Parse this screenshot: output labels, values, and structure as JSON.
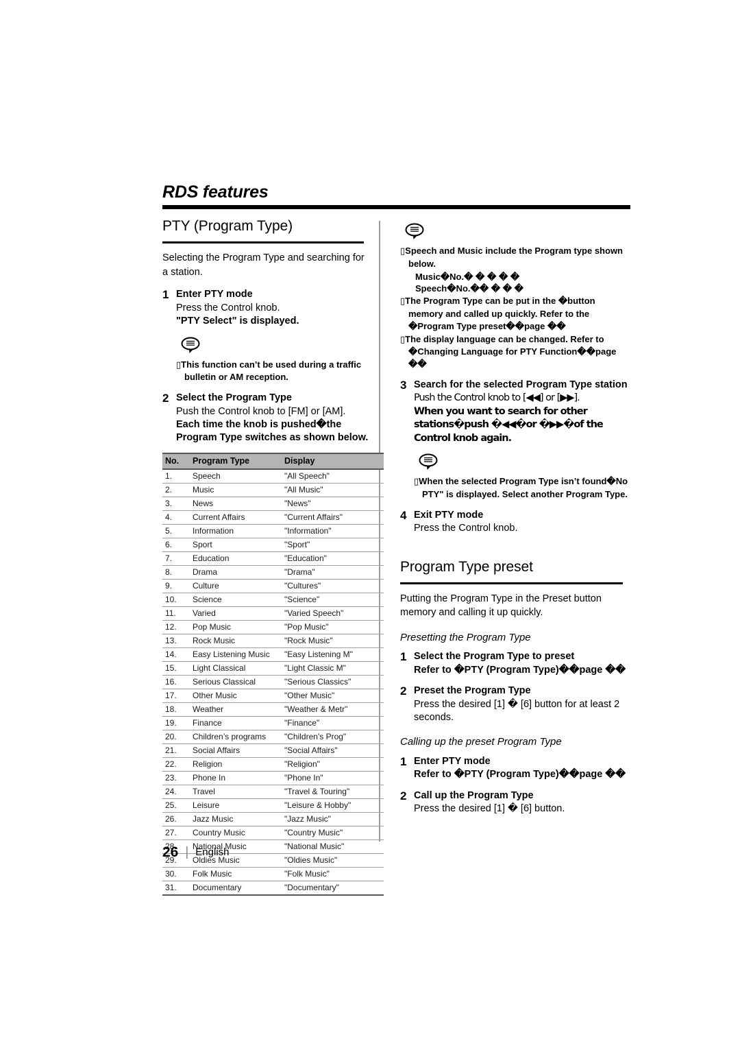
{
  "header": {
    "chapter_title": "RDS features"
  },
  "left_column": {
    "section": {
      "heading": "PTY (Program Type)",
      "intro": "Selecting the Program Type and searching for a station."
    },
    "steps": [
      {
        "num": "1",
        "title": "Enter PTY mode",
        "lines": [
          {
            "text": "Press the Control knob.",
            "bold": false
          },
          {
            "text": "\"PTY Select\" is displayed.",
            "bold": true
          }
        ]
      },
      {
        "num": "2",
        "title": "Select the Program Type",
        "lines": [
          {
            "text": "Push the Control knob to [FM] or [AM].",
            "bold": false
          },
          {
            "text": "Each time the knob is pushed�the Program Type switches as shown below.",
            "bold": true
          }
        ]
      }
    ],
    "note": {
      "icon": "speech-bubble-note-icon",
      "items": [
        "This function can’t be used during a traffic bulletin or AM reception."
      ]
    },
    "table": {
      "columns": [
        "No.",
        "Program Type",
        "Display"
      ],
      "rows": [
        [
          "1.",
          "Speech",
          "\"All Speech\""
        ],
        [
          "2.",
          "Music",
          "\"All Music\""
        ],
        [
          "3.",
          "News",
          "\"News\""
        ],
        [
          "4.",
          "Current Affairs",
          "\"Current Affairs\""
        ],
        [
          "5.",
          "Information",
          "\"Information\""
        ],
        [
          "6.",
          "Sport",
          "\"Sport\""
        ],
        [
          "7.",
          "Education",
          "\"Education\""
        ],
        [
          "8.",
          "Drama",
          "\"Drama\""
        ],
        [
          "9.",
          "Culture",
          "\"Cultures\""
        ],
        [
          "10.",
          "Science",
          "\"Science\""
        ],
        [
          "11.",
          "Varied",
          "\"Varied Speech\""
        ],
        [
          "12.",
          "Pop Music",
          "\"Pop Music\""
        ],
        [
          "13.",
          "Rock Music",
          "\"Rock Music\""
        ],
        [
          "14.",
          "Easy Listening Music",
          "\"Easy Listening M\""
        ],
        [
          "15.",
          "Light Classical",
          "\"Light Classic M\""
        ],
        [
          "16.",
          "Serious Classical",
          "\"Serious Classics\""
        ],
        [
          "17.",
          "Other Music",
          "\"Other Music\""
        ],
        [
          "18.",
          "Weather",
          "\"Weather & Metr\""
        ],
        [
          "19.",
          "Finance",
          "\"Finance\""
        ],
        [
          "20.",
          "Children’s programs",
          "\"Children's Prog\""
        ],
        [
          "21.",
          "Social Affairs",
          "\"Social Affairs\""
        ],
        [
          "22.",
          "Religion",
          "\"Religion\""
        ],
        [
          "23.",
          "Phone In",
          "\"Phone In\""
        ],
        [
          "24.",
          "Travel",
          "\"Travel & Touring\""
        ],
        [
          "25.",
          "Leisure",
          "\"Leisure & Hobby\""
        ],
        [
          "26.",
          "Jazz Music",
          "\"Jazz Music\""
        ],
        [
          "27.",
          "Country Music",
          "\"Country Music\""
        ],
        [
          "28.",
          "National Music",
          "\"National Music\""
        ],
        [
          "29.",
          "Oldies Music",
          "\"Oldies Music\""
        ],
        [
          "30.",
          "Folk Music",
          "\"Folk Music\""
        ],
        [
          "31.",
          "Documentary",
          "\"Documentary\""
        ]
      ]
    }
  },
  "right_column": {
    "top_note": {
      "icon": "speech-bubble-note-icon",
      "item1": "Speech and Music include the Program type shown below.",
      "music_line": "Music�No.� �  �    �  �",
      "speech_line": "Speech�No.��  �    �  �",
      "item2": "The Program Type can be put in the �button memory and called up quickly. Refer to the �Program Type preset��page ��",
      "item3": "The display language can be changed. Refer to �Changing Language for PTY Function��page ��"
    },
    "steps": [
      {
        "num": "3",
        "title": "Search for the selected Program Type station",
        "lines": [
          {
            "text": "Push the Control knob to [◀◀] or [▶▶].",
            "bold": false
          },
          {
            "text": "When you want to search for other stations�push �◀◀�or �▶▶�of the Control knob again.",
            "bold": true
          }
        ]
      },
      {
        "num": "4",
        "title": "Exit PTY mode",
        "lines": [
          {
            "text": "Press the Control knob.",
            "bold": false
          }
        ]
      }
    ],
    "mid_note": {
      "icon": "speech-bubble-note-icon",
      "items": [
        "When the selected Program Type isn’t found�No PTY\" is displayed. Select another Program Type."
      ]
    },
    "preset_section": {
      "heading": "Program Type preset",
      "intro": "Putting the Program Type in the Preset button memory and calling it up quickly.",
      "sub1": "Presetting the Program Type",
      "sub1_steps": [
        {
          "num": "1",
          "title": "Select the Program Type to preset",
          "lines": [
            {
              "text": "Refer to �PTY (Program Type)��page ��",
              "bold": true
            }
          ]
        },
        {
          "num": "2",
          "title": "Preset the Program Type",
          "lines": [
            {
              "text": "Press the desired [1] �  [6] button for at least 2 seconds.",
              "bold": true
            }
          ]
        }
      ],
      "sub2": "Calling up the preset Program Type",
      "sub2_steps": [
        {
          "num": "1",
          "title": "Enter PTY mode",
          "lines": [
            {
              "text": "Refer to �PTY (Program Type)��page ��",
              "bold": true
            }
          ]
        },
        {
          "num": "2",
          "title": "Call up the Program Type",
          "lines": [
            {
              "text": "Press the desired [1] �  [6] button.",
              "bold": true
            }
          ]
        }
      ]
    }
  },
  "footer": {
    "page_number": "26",
    "separator": "|",
    "language": "English"
  }
}
